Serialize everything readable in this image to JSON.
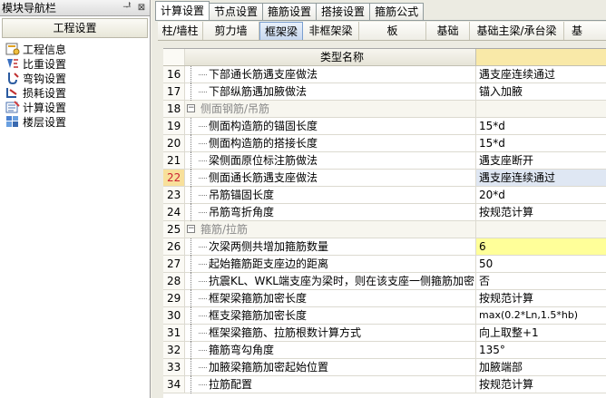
{
  "nav": {
    "title": "模块导航栏",
    "pin_glyph": "ᆤ",
    "close_glyph": "⊠",
    "section": "工程设置",
    "items": [
      {
        "label": "工程信息",
        "icon": "project-info-icon"
      },
      {
        "label": "比重设置",
        "icon": "weight-icon"
      },
      {
        "label": "弯钩设置",
        "icon": "hook-icon"
      },
      {
        "label": "损耗设置",
        "icon": "loss-icon"
      },
      {
        "label": "计算设置",
        "icon": "calc-icon"
      },
      {
        "label": "楼层设置",
        "icon": "floor-icon"
      }
    ]
  },
  "tabs": [
    "计算设置",
    "节点设置",
    "箍筋设置",
    "搭接设置",
    "箍筋公式"
  ],
  "active_tab": 0,
  "subtabs": [
    "柱/墙柱",
    "剪力墙",
    "框架梁",
    "非框架梁",
    "板",
    "基础",
    "基础主梁/承台梁",
    "基"
  ],
  "active_subtab": 2,
  "grid": {
    "header": "类型名称",
    "rows": [
      {
        "num": "16",
        "name": "下部通长筋遇支座做法",
        "value": "遇支座连续通过",
        "kind": "child"
      },
      {
        "num": "17",
        "name": "下部纵筋遇加腋做法",
        "value": "锚入加腋",
        "kind": "child"
      },
      {
        "num": "18",
        "name": "侧面钢筋/吊筋",
        "value": "",
        "kind": "group"
      },
      {
        "num": "19",
        "name": "侧面构造筋的锚固长度",
        "value": "15*d",
        "kind": "child"
      },
      {
        "num": "20",
        "name": "侧面构造筋的搭接长度",
        "value": "15*d",
        "kind": "child"
      },
      {
        "num": "21",
        "name": "梁侧面原位标注筋做法",
        "value": "遇支座断开",
        "kind": "child"
      },
      {
        "num": "22",
        "name": "侧面通长筋遇支座做法",
        "value": "遇支座连续通过",
        "kind": "child sel"
      },
      {
        "num": "23",
        "name": "吊筋锚固长度",
        "value": "20*d",
        "kind": "child"
      },
      {
        "num": "24",
        "name": "吊筋弯折角度",
        "value": "按规范计算",
        "kind": "child"
      },
      {
        "num": "25",
        "name": "箍筋/拉筋",
        "value": "",
        "kind": "group"
      },
      {
        "num": "26",
        "name": "次梁两侧共增加箍筋数量",
        "value": "6",
        "kind": "child hl"
      },
      {
        "num": "27",
        "name": "起始箍筋距支座边的距离",
        "value": "50",
        "kind": "child"
      },
      {
        "num": "28",
        "name": "抗震KL、WKL端支座为梁时，则在该支座一侧箍筋加密",
        "value": "否",
        "kind": "child"
      },
      {
        "num": "29",
        "name": "框架梁箍筋加密长度",
        "value": "按规范计算",
        "kind": "child"
      },
      {
        "num": "30",
        "name": "框支梁箍筋加密长度",
        "value": "max(0.2*Ln,1.5*hb)",
        "kind": "child mono"
      },
      {
        "num": "31",
        "name": "框架梁箍筋、拉筋根数计算方式",
        "value": "向上取整+1",
        "kind": "child"
      },
      {
        "num": "32",
        "name": "箍筋弯勾角度",
        "value": "135°",
        "kind": "child"
      },
      {
        "num": "33",
        "name": "加腋梁箍筋加密起始位置",
        "value": "加腋端部",
        "kind": "child"
      },
      {
        "num": "34",
        "name": "拉筋配置",
        "value": "按规范计算",
        "kind": "child"
      }
    ]
  }
}
